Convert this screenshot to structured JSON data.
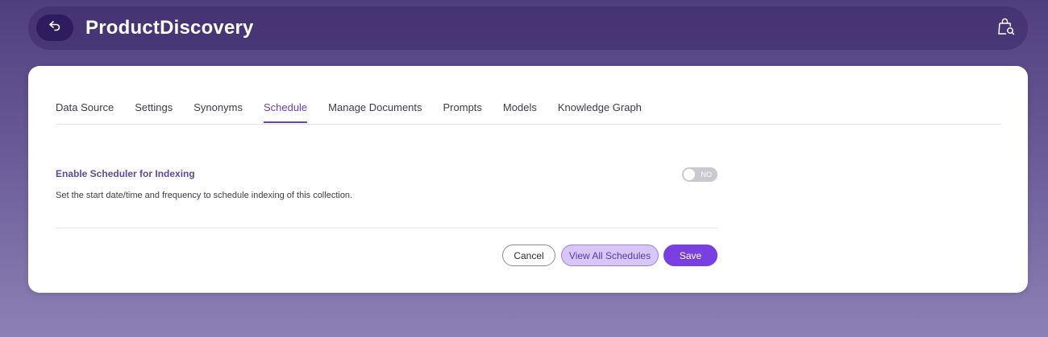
{
  "header": {
    "title": "ProductDiscovery",
    "back_icon": "undo-arrow-icon",
    "right_icon": "shopping-bag-search-icon"
  },
  "tabs": [
    {
      "label": "Data Source",
      "active": false
    },
    {
      "label": "Settings",
      "active": false
    },
    {
      "label": "Synonyms",
      "active": false
    },
    {
      "label": "Schedule",
      "active": true
    },
    {
      "label": "Manage Documents",
      "active": false
    },
    {
      "label": "Prompts",
      "active": false
    },
    {
      "label": "Models",
      "active": false
    },
    {
      "label": "Knowledge Graph",
      "active": false
    }
  ],
  "scheduler": {
    "title": "Enable Scheduler for Indexing",
    "description": "Set the start date/time and frequency to schedule indexing of this collection.",
    "toggle_label": "NO",
    "enabled": false
  },
  "actions": {
    "cancel_label": "Cancel",
    "view_all_label": "View All Schedules",
    "save_label": "Save"
  },
  "colors": {
    "accent": "#6d3ec8",
    "save_bg": "#7a3fe0",
    "view_all_bg": "#d7c6f6",
    "header_bg": "#3c2a69",
    "title_color": "#5e4a9e"
  }
}
